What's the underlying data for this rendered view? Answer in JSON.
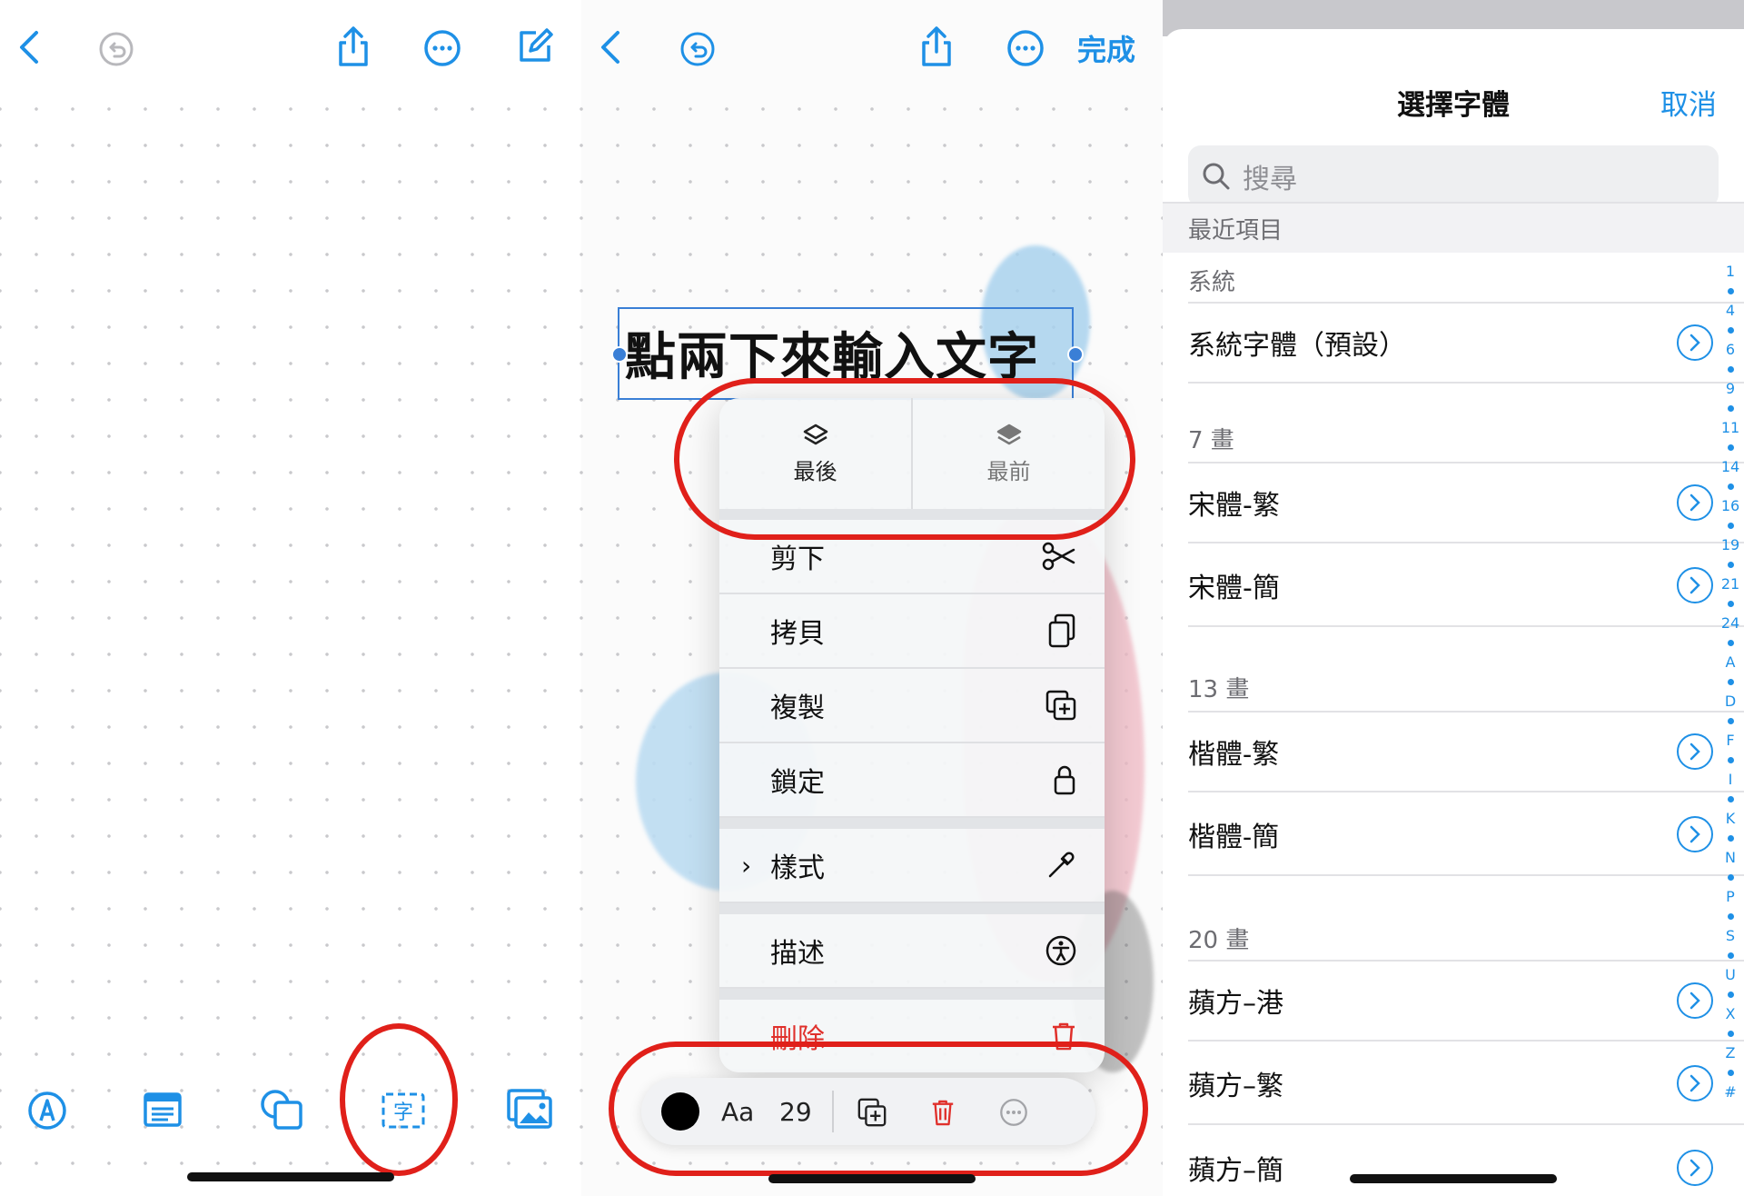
{
  "panel2": {
    "done_label": "完成",
    "textbox_text": "點兩下來輸入文字",
    "menu": {
      "send_back": "最後",
      "bring_front": "最前",
      "cut": "剪下",
      "copy": "拷貝",
      "duplicate": "複製",
      "lock": "鎖定",
      "style": "樣式",
      "describe": "描述",
      "delete": "刪除"
    },
    "toolbar": {
      "font_label": "Aa",
      "font_size": "29"
    }
  },
  "panel3": {
    "title": "選擇字體",
    "cancel": "取消",
    "search_placeholder": "搜尋",
    "recent_header": "最近項目",
    "sections": [
      {
        "label": "系統",
        "fonts": [
          "系統字體（預設）"
        ]
      },
      {
        "label": "7 畫",
        "fonts": [
          "宋體-繁",
          "宋體-簡"
        ]
      },
      {
        "label": "13 畫",
        "fonts": [
          "楷體-繁",
          "楷體-簡"
        ]
      },
      {
        "label": "20 畫",
        "fonts": [
          "蘋方–港",
          "蘋方–繁",
          "蘋方–簡"
        ]
      }
    ],
    "index": [
      "1",
      "4",
      "6",
      "9",
      "11",
      "14",
      "16",
      "19",
      "21",
      "24",
      "A",
      "D",
      "F",
      "I",
      "K",
      "N",
      "P",
      "S",
      "U",
      "X",
      "Z",
      "#"
    ]
  },
  "colors": {
    "accent": "#1e90e6",
    "annotation": "#e0201a",
    "danger": "#e0302b"
  }
}
